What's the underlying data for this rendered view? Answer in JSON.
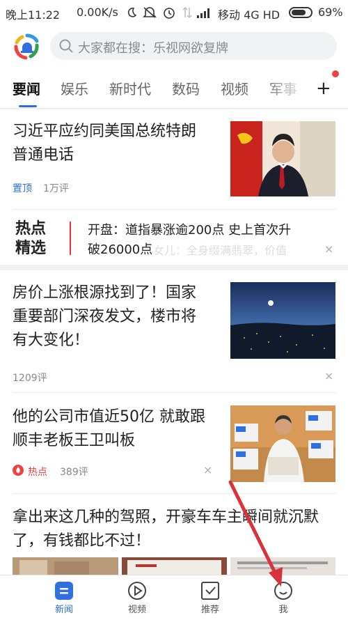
{
  "status_bar": {
    "time": "晚上11:22",
    "speed": "0.00K/s",
    "carrier": "移动 4G HD",
    "battery": "69%"
  },
  "search": {
    "placeholder": "大家都在搜：乐视网欲复牌"
  },
  "tabs": [
    {
      "label": "要闻",
      "active": true
    },
    {
      "label": "娱乐"
    },
    {
      "label": "新时代"
    },
    {
      "label": "数码"
    },
    {
      "label": "视频"
    },
    {
      "label": "军事"
    }
  ],
  "add_tab": "+",
  "news": [
    {
      "title_lines": [
        "习近平应约同美国总统特朗",
        "普通电话"
      ],
      "pin": "置顶",
      "comments": "1万评"
    },
    {
      "hot_logo": [
        "热点",
        "精选"
      ],
      "lines": [
        "开盘：道指暴涨逾200点 史上首次升",
        "破26000点"
      ],
      "ghost": "女儿：全身缀满翡翠，价值"
    },
    {
      "title_lines": [
        "房价上涨根源找到了！国家",
        "重要部门深夜发文，楼市将",
        "有大变化！"
      ],
      "comments": "1209评"
    },
    {
      "title_lines": [
        "他的公司市值近50亿 就敢跟",
        "顺丰老板王卫叫板"
      ],
      "hot": "热点",
      "comments": "389评"
    },
    {
      "title_lines": [
        "拿出来这几种的驾照，开豪车车主瞬间就沉默",
        "了，有钱都比不过！"
      ]
    }
  ],
  "close_glyph": "×",
  "bottom_nav": [
    {
      "label": "新闻",
      "icon": "news-icon",
      "active": true
    },
    {
      "label": "视频",
      "icon": "play-icon"
    },
    {
      "label": "推荐",
      "icon": "recommend-icon"
    },
    {
      "label": "我",
      "icon": "profile-icon"
    }
  ],
  "colors": {
    "accent": "#2f6fe0",
    "hot": "#f0413e",
    "arrow": "#d9323a"
  }
}
